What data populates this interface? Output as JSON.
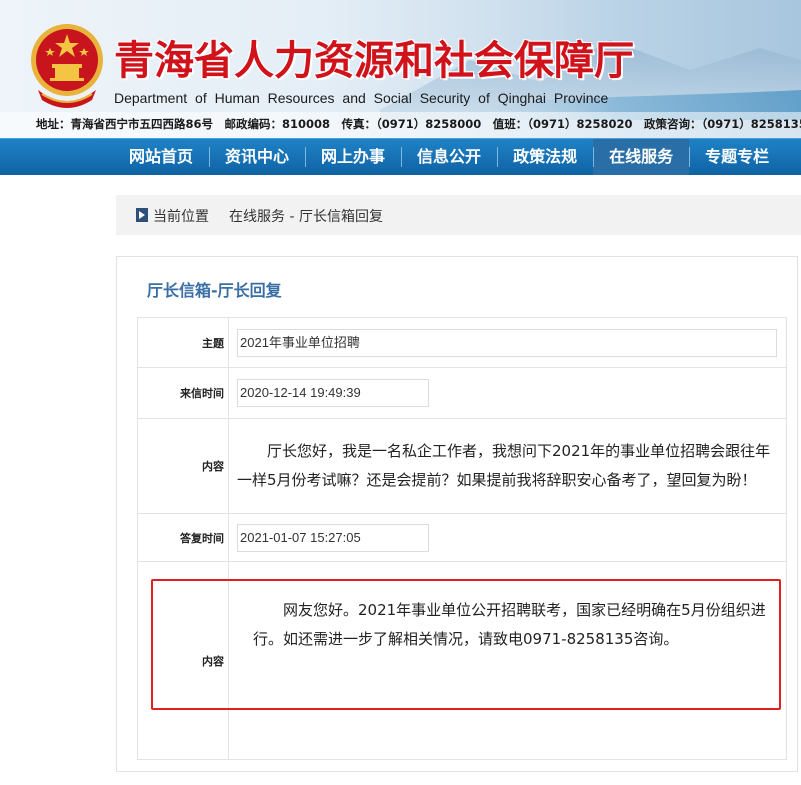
{
  "header": {
    "site_title": "青海省人力资源和社会保障厅",
    "site_subtitle": "Department of Human Resources and Social Security of Qinghai Province",
    "contact_line": "地址：青海省西宁市五四西路86号　邮政编码：810008　传真：（0971）8258000　值班：（0971）8258020　政策咨询：（0971）8258135"
  },
  "nav": {
    "items": [
      {
        "label": "网站首页"
      },
      {
        "label": "资讯中心"
      },
      {
        "label": "网上办事"
      },
      {
        "label": "信息公开"
      },
      {
        "label": "政策法规"
      },
      {
        "label": "在线服务",
        "active": true
      },
      {
        "label": "专题专栏"
      }
    ]
  },
  "breadcrumb": {
    "label": "当前位置",
    "path": "在线服务 - 厅长信箱回复"
  },
  "panel": {
    "title": "厅长信箱-厅长回复",
    "fields": {
      "subject_label": "主题",
      "subject_value": "2021年事业单位招聘",
      "sent_time_label": "来信时间",
      "sent_time_value": "2020-12-14 19:49:39",
      "content_label": "内容",
      "content_value": "厅长您好，我是一名私企工作者，我想问下2021年的事业单位招聘会跟往年一样5月份考试嘛？还是会提前？如果提前我将辞职安心备考了，望回复为盼！",
      "reply_time_label": "答复时间",
      "reply_time_value": "2021-01-07 15:27:05",
      "reply_content_label": "内容",
      "reply_content_value": "网友您好。2021年事业单位公开招聘联考，国家已经明确在5月份组织进行。如还需进一步了解相关情况，请致电0971-8258135咨询。"
    }
  },
  "colors": {
    "title_red": "#d0121b",
    "nav_blue": "#1577bb",
    "panel_title_blue": "#3a6fa5",
    "highlight_red": "#e02020"
  },
  "icons": {
    "emblem": "national-emblem-icon",
    "breadcrumb_arrow": "triangle-right-icon"
  }
}
